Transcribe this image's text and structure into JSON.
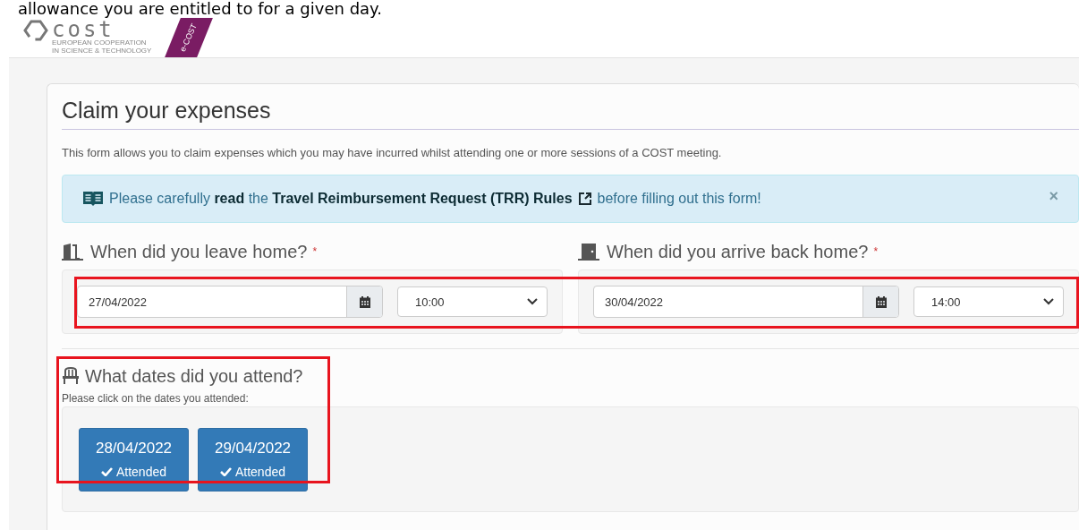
{
  "caption": "allowance you are entitled to for a given day.",
  "logo": {
    "name": "cost",
    "tagline_1": "EUROPEAN COOPERATION",
    "tagline_2": "IN SCIENCE & TECHNOLOGY",
    "ribbon": "e-COST"
  },
  "form": {
    "title": "Claim your expenses",
    "description": "This form allows you to claim expenses which you may have incurred whilst attending one or more sessions of a COST meeting.",
    "alert": {
      "text": "Please carefully **read** the **Travel Reimbursement Request (TRR) Rules**",
      "text_after": "before filling out this form!",
      "close": "×"
    },
    "travel": {
      "highlighted": true,
      "legs": [
        {
          "kind": "leave",
          "label": "When did you leave home?",
          "required_mark": "*",
          "date": "27/04/2022",
          "time": "10:00"
        },
        {
          "kind": "arrive",
          "label": "When did you arrive back home?",
          "required_mark": "*",
          "date": "30/04/2022",
          "time": "14:00"
        }
      ]
    },
    "attendance": {
      "highlighted": true,
      "label": "What dates did you attend?",
      "hint": "Please click on the dates you attended:",
      "dates": [
        {
          "date": "28/04/2022",
          "status": "Attended",
          "selected": true
        },
        {
          "date": "29/04/2022",
          "status": "Attended",
          "selected": true
        }
      ]
    }
  }
}
